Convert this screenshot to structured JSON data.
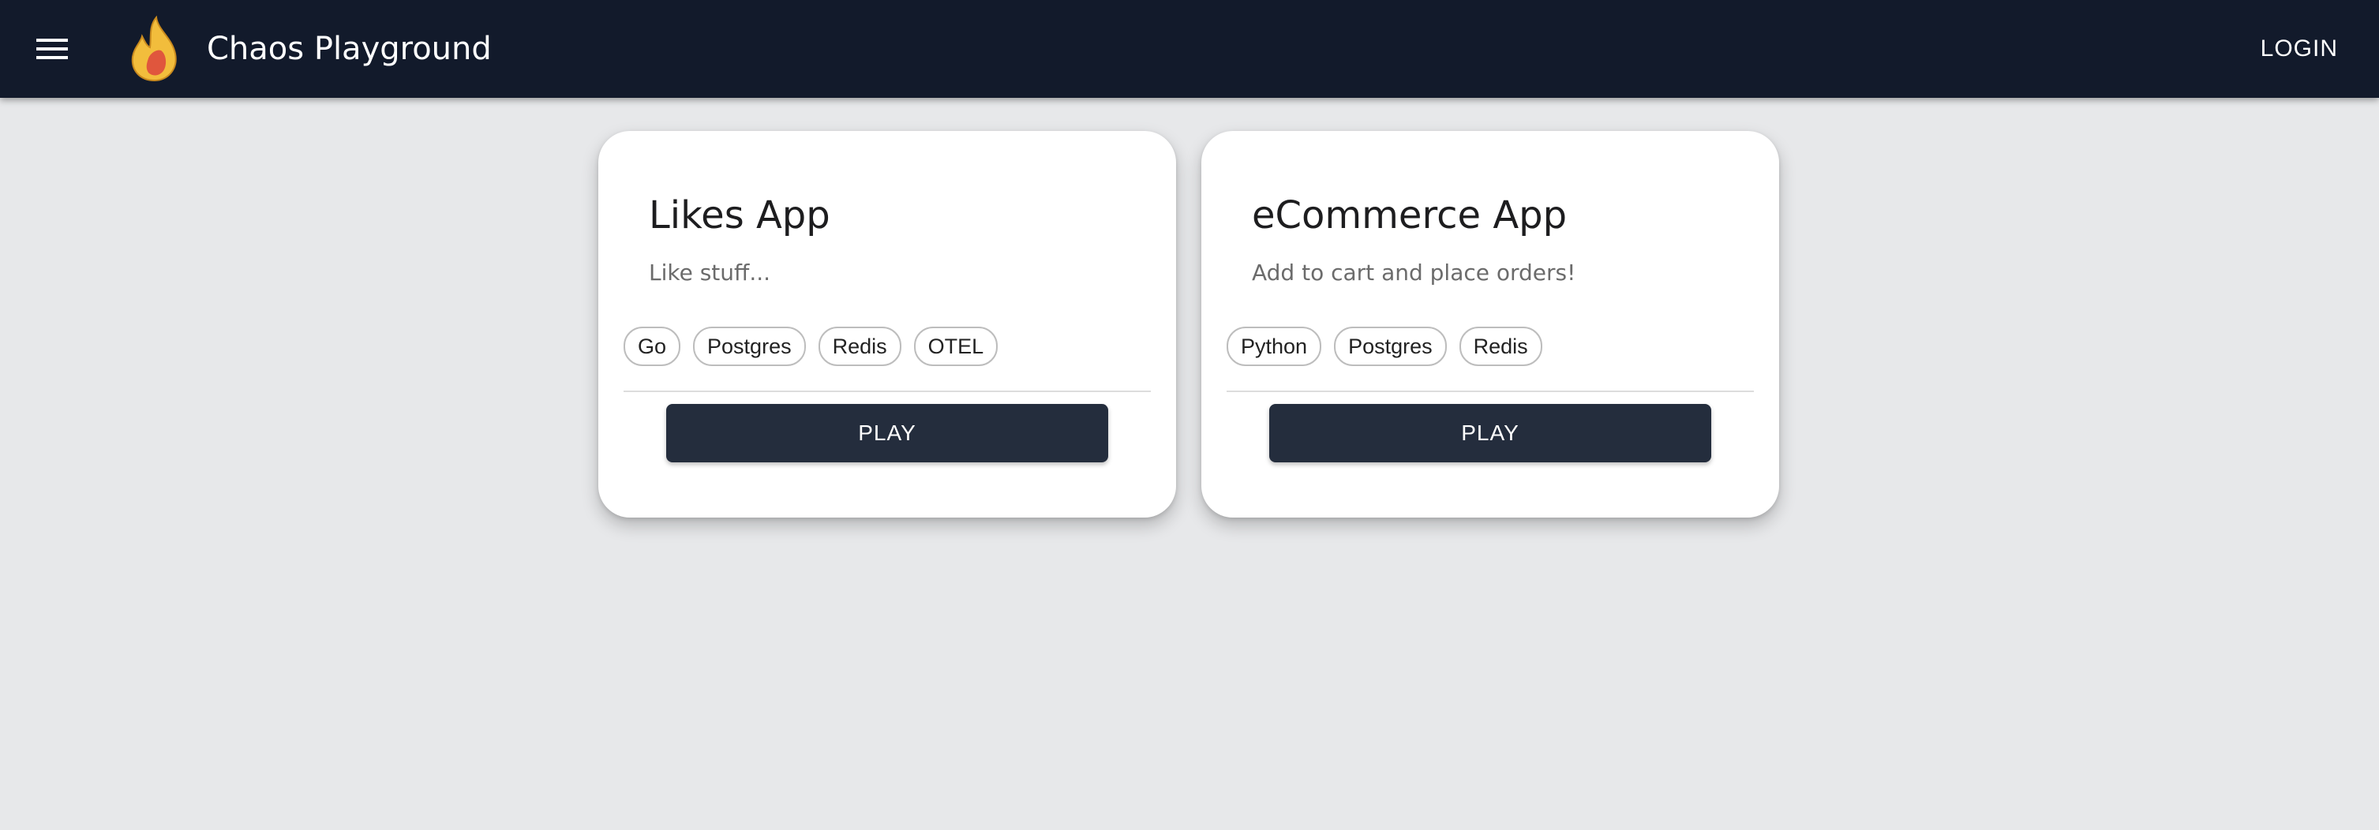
{
  "header": {
    "menu_icon": "hamburger-menu-icon",
    "logo_icon": "fire-icon",
    "title": "Chaos Playground",
    "login_label": "LOGIN",
    "background_color": "#121a2b"
  },
  "cards": [
    {
      "title": "Likes App",
      "description": "Like stuff...",
      "tags": [
        "Go",
        "Postgres",
        "Redis",
        "OTEL"
      ],
      "button_label": "PLAY"
    },
    {
      "title": "eCommerce App",
      "description": "Add to cart and place orders!",
      "tags": [
        "Python",
        "Postgres",
        "Redis"
      ],
      "button_label": "PLAY"
    }
  ],
  "colors": {
    "page_background": "#e7e8ea",
    "button_background": "#242d3d",
    "logo_flame_outer": "#f2bd3c",
    "logo_flame_inner": "#e0563d"
  }
}
